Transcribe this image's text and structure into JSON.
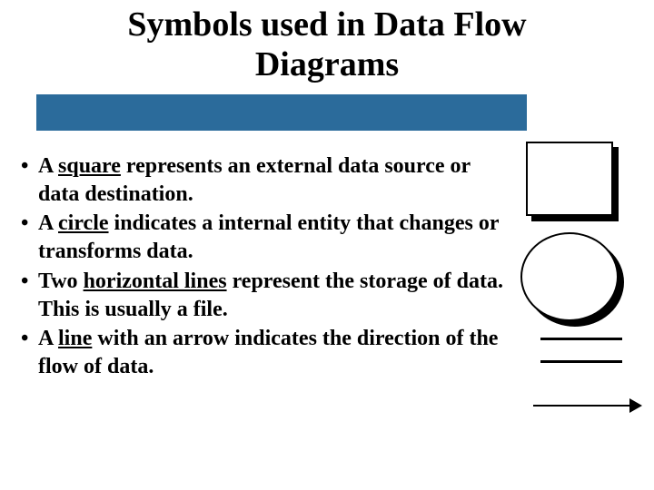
{
  "title_line1": "Symbols used in Data Flow",
  "title_line2": "Diagrams",
  "bullets": [
    {
      "pre": "A ",
      "term": "square",
      "post": " represents an external data source or data destination."
    },
    {
      "pre": "A ",
      "term": "circle",
      "post": " indicates a internal entity that changes or transforms data."
    },
    {
      "pre": "Two ",
      "term": "horizontal lines",
      "post": " represent the storage of data. This is usually a file."
    },
    {
      "pre": "A ",
      "term": "line",
      "post": " with an arrow indicates the direction of the flow of data."
    }
  ]
}
